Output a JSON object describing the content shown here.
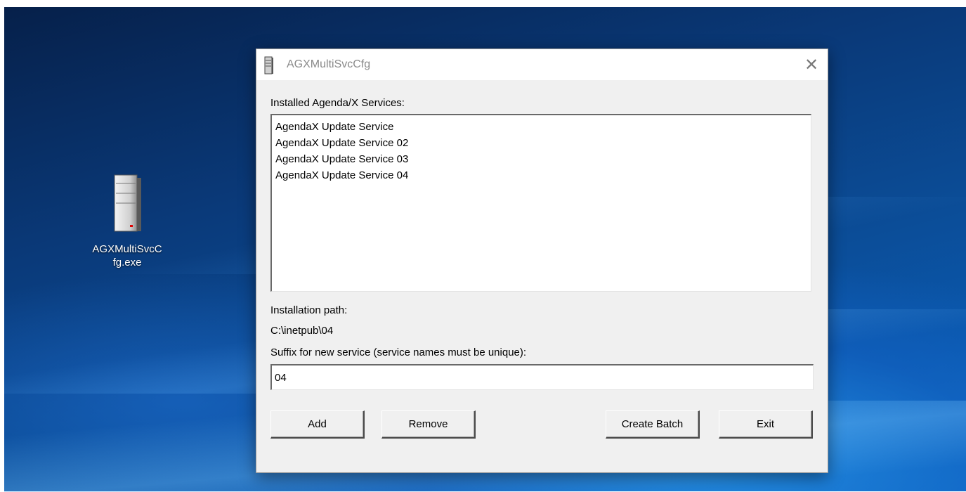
{
  "desktop": {
    "icon_label": "AGXMultiSvcCfg.exe",
    "icon": "server-tower-icon"
  },
  "window": {
    "title": "AGXMultiSvcCfg",
    "title_icon": "server-tower-icon",
    "close_glyph": "✕",
    "services_label": "Installed Agenda/X Services:",
    "services": [
      "AgendaX Update Service",
      "AgendaX Update Service 02",
      "AgendaX Update Service 03",
      "AgendaX Update Service 04"
    ],
    "install_path_label": "Installation path:",
    "install_path_value": "C:\\inetpub\\04",
    "suffix_label": "Suffix for new service (service names must be unique):",
    "suffix_value": "04",
    "buttons": {
      "add": "Add",
      "remove": "Remove",
      "create_batch": "Create Batch",
      "exit": "Exit"
    }
  }
}
